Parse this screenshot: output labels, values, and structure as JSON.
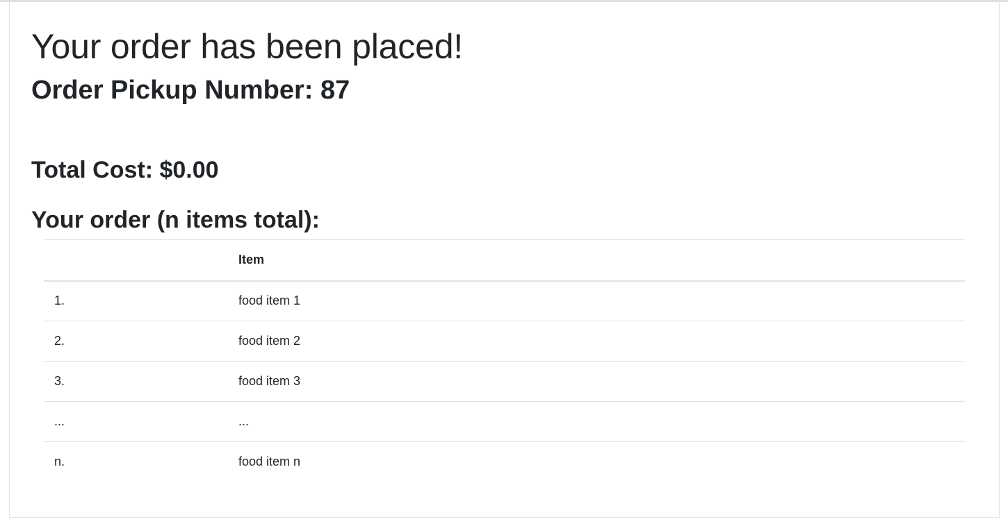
{
  "header": {
    "title": "Your order has been placed!",
    "pickup_label": "Order Pickup Number: ",
    "pickup_number": "87"
  },
  "summary": {
    "total_cost": "Total Cost: $0.00",
    "order_heading": "Your order (n items total):"
  },
  "table": {
    "columns": [
      "",
      "Item"
    ],
    "rows": [
      {
        "num": "1.",
        "item": "food item 1"
      },
      {
        "num": "2.",
        "item": "food item 2"
      },
      {
        "num": "3.",
        "item": "food item 3"
      },
      {
        "num": "...",
        "item": "..."
      },
      {
        "num": "n.",
        "item": "food item n"
      }
    ]
  }
}
